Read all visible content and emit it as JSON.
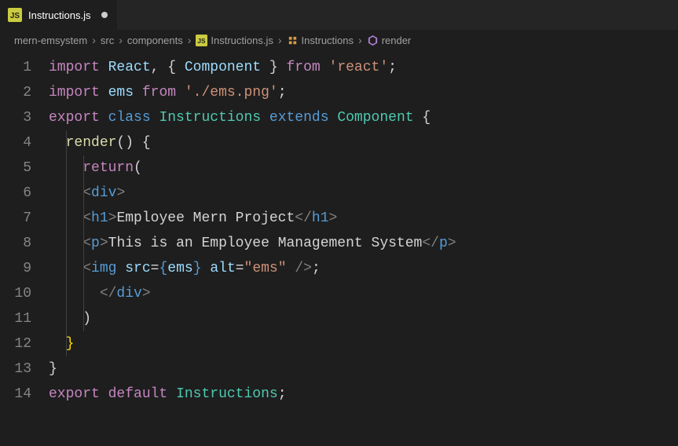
{
  "tab": {
    "file_icon": "JS",
    "filename": "Instructions.js",
    "dirty": true
  },
  "breadcrumb": {
    "items": [
      {
        "label": "mern-emsystem",
        "icon": null
      },
      {
        "label": "src",
        "icon": null
      },
      {
        "label": "components",
        "icon": null
      },
      {
        "label": "Instructions.js",
        "icon": "js-file-icon"
      },
      {
        "label": "Instructions",
        "icon": "class-icon"
      },
      {
        "label": "render",
        "icon": "method-icon"
      }
    ]
  },
  "code": {
    "line_numbers": [
      "1",
      "2",
      "3",
      "4",
      "5",
      "6",
      "7",
      "8",
      "9",
      "10",
      "11",
      "12",
      "13",
      "14"
    ],
    "lines": [
      [
        {
          "cls": "tk-kw",
          "t": "import"
        },
        {
          "cls": "tk-punc",
          "t": " "
        },
        {
          "cls": "tk-var",
          "t": "React"
        },
        {
          "cls": "tk-punc",
          "t": ", { "
        },
        {
          "cls": "tk-var",
          "t": "Component"
        },
        {
          "cls": "tk-punc",
          "t": " } "
        },
        {
          "cls": "tk-kw",
          "t": "from"
        },
        {
          "cls": "tk-punc",
          "t": " "
        },
        {
          "cls": "tk-str",
          "t": "'react'"
        },
        {
          "cls": "tk-punc",
          "t": ";"
        }
      ],
      [
        {
          "cls": "tk-kw",
          "t": "import"
        },
        {
          "cls": "tk-punc",
          "t": " "
        },
        {
          "cls": "tk-var",
          "t": "ems"
        },
        {
          "cls": "tk-punc",
          "t": " "
        },
        {
          "cls": "tk-kw",
          "t": "from"
        },
        {
          "cls": "tk-punc",
          "t": " "
        },
        {
          "cls": "tk-str",
          "t": "'./ems.png'"
        },
        {
          "cls": "tk-punc",
          "t": ";"
        }
      ],
      [
        {
          "cls": "tk-kw",
          "t": "export"
        },
        {
          "cls": "tk-punc",
          "t": " "
        },
        {
          "cls": "tk-el",
          "t": "class"
        },
        {
          "cls": "tk-punc",
          "t": " "
        },
        {
          "cls": "tk-type",
          "t": "Instructions"
        },
        {
          "cls": "tk-punc",
          "t": " "
        },
        {
          "cls": "tk-el",
          "t": "extends"
        },
        {
          "cls": "tk-punc",
          "t": " "
        },
        {
          "cls": "tk-type",
          "t": "Component"
        },
        {
          "cls": "tk-punc",
          "t": " {"
        }
      ],
      [
        {
          "cls": "tk-punc",
          "t": "  "
        },
        {
          "cls": "tk-fn",
          "t": "render"
        },
        {
          "cls": "tk-punc",
          "t": "() {"
        }
      ],
      [
        {
          "cls": "tk-punc",
          "t": "    "
        },
        {
          "cls": "tk-kw",
          "t": "return"
        },
        {
          "cls": "tk-punc",
          "t": "("
        }
      ],
      [
        {
          "cls": "tk-punc",
          "t": "    "
        },
        {
          "cls": "tk-tag",
          "t": "<"
        },
        {
          "cls": "tk-el",
          "t": "div"
        },
        {
          "cls": "tk-tag",
          "t": ">"
        }
      ],
      [
        {
          "cls": "tk-punc",
          "t": "    "
        },
        {
          "cls": "tk-tag",
          "t": "<"
        },
        {
          "cls": "tk-el",
          "t": "h1"
        },
        {
          "cls": "tk-tag",
          "t": ">"
        },
        {
          "cls": "tk-txt",
          "t": "Employee Mern Project"
        },
        {
          "cls": "tk-tag",
          "t": "</"
        },
        {
          "cls": "tk-el",
          "t": "h1"
        },
        {
          "cls": "tk-tag",
          "t": ">"
        }
      ],
      [
        {
          "cls": "tk-punc",
          "t": "    "
        },
        {
          "cls": "tk-tag",
          "t": "<"
        },
        {
          "cls": "tk-el",
          "t": "p"
        },
        {
          "cls": "tk-tag",
          "t": ">"
        },
        {
          "cls": "tk-txt",
          "t": "This is an Employee Management System"
        },
        {
          "cls": "tk-tag",
          "t": "</"
        },
        {
          "cls": "tk-el",
          "t": "p"
        },
        {
          "cls": "tk-tag",
          "t": ">"
        }
      ],
      [
        {
          "cls": "tk-punc",
          "t": "    "
        },
        {
          "cls": "tk-tag",
          "t": "<"
        },
        {
          "cls": "tk-el",
          "t": "img"
        },
        {
          "cls": "tk-punc",
          "t": " "
        },
        {
          "cls": "tk-attr",
          "t": "src"
        },
        {
          "cls": "tk-punc",
          "t": "="
        },
        {
          "cls": "tk-el",
          "t": "{"
        },
        {
          "cls": "tk-var",
          "t": "ems"
        },
        {
          "cls": "tk-el",
          "t": "}"
        },
        {
          "cls": "tk-punc",
          "t": " "
        },
        {
          "cls": "tk-attr",
          "t": "alt"
        },
        {
          "cls": "tk-punc",
          "t": "="
        },
        {
          "cls": "tk-str",
          "t": "\"ems\""
        },
        {
          "cls": "tk-punc",
          "t": " "
        },
        {
          "cls": "tk-tag",
          "t": "/>"
        },
        {
          "cls": "tk-punc",
          "t": ";"
        }
      ],
      [
        {
          "cls": "tk-punc",
          "t": "      "
        },
        {
          "cls": "tk-tag",
          "t": "</"
        },
        {
          "cls": "tk-el",
          "t": "div"
        },
        {
          "cls": "tk-tag",
          "t": ">"
        }
      ],
      [
        {
          "cls": "tk-punc",
          "t": "    )"
        }
      ],
      [
        {
          "cls": "tk-punc",
          "t": "  "
        },
        {
          "cls": "tk-brc",
          "t": "}"
        }
      ],
      [
        {
          "cls": "tk-punc",
          "t": "}"
        }
      ],
      [
        {
          "cls": "tk-kw",
          "t": "export"
        },
        {
          "cls": "tk-punc",
          "t": " "
        },
        {
          "cls": "tk-kw",
          "t": "default"
        },
        {
          "cls": "tk-punc",
          "t": " "
        },
        {
          "cls": "tk-type",
          "t": "Instructions"
        },
        {
          "cls": "tk-punc",
          "t": ";"
        }
      ]
    ]
  }
}
